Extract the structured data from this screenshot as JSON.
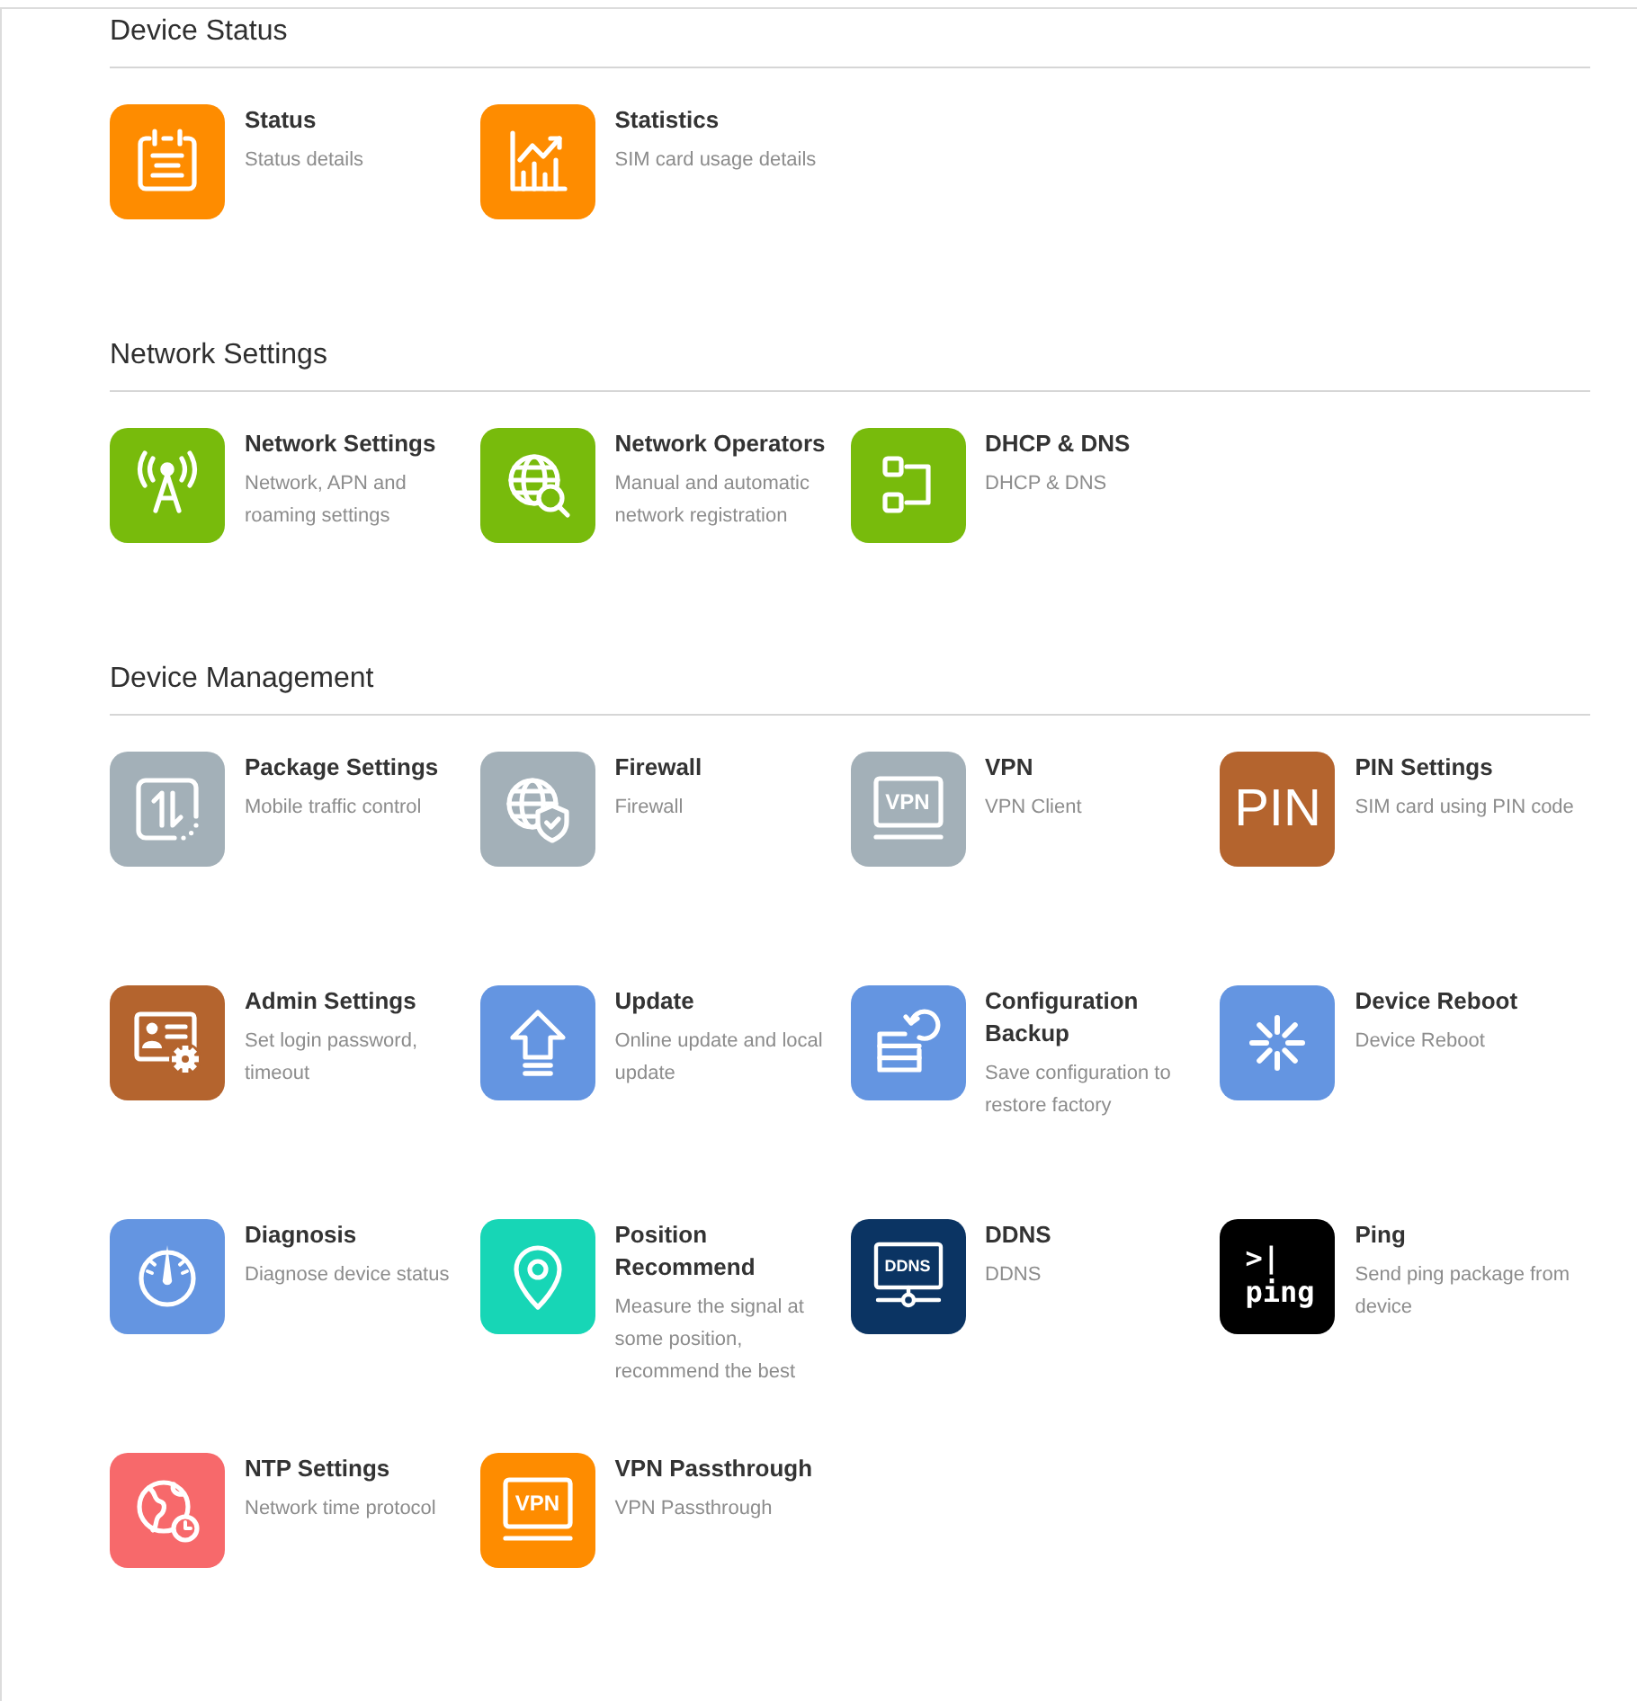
{
  "sections": [
    {
      "title": "Device Status",
      "items": [
        {
          "title": "Status",
          "description": "Status details",
          "color": "#fe8c00"
        },
        {
          "title": "Statistics",
          "description": "SIM card usage details",
          "color": "#fe8c00"
        }
      ]
    },
    {
      "title": "Network Settings",
      "items": [
        {
          "title": "Network Settings",
          "description": "Network, APN and roaming settings",
          "color": "#78bb0c"
        },
        {
          "title": "Network Operators",
          "description": "Manual and automatic network registration",
          "color": "#78bb0c"
        },
        {
          "title": "DHCP & DNS",
          "description": "DHCP & DNS",
          "color": "#78bb0c"
        }
      ]
    },
    {
      "title": "Device Management",
      "items": [
        {
          "title": "Package Settings",
          "description": "Mobile traffic control",
          "color": "#a3b0b8"
        },
        {
          "title": "Firewall",
          "description": "Firewall",
          "color": "#a3b0b8"
        },
        {
          "title": "VPN",
          "description": "VPN Client",
          "color": "#a3b0b8",
          "icon_text": "VPN"
        },
        {
          "title": "PIN Settings",
          "description": "SIM card using PIN code",
          "color": "#b4642e",
          "icon_text": "PIN"
        },
        {
          "title": "Admin Settings",
          "description": "Set login password, timeout",
          "color": "#b4642e"
        },
        {
          "title": "Update",
          "description": "Online update and local update",
          "color": "#6495e1"
        },
        {
          "title": "Configuration Backup",
          "description": "Save configuration to restore factory",
          "color": "#6495e1"
        },
        {
          "title": "Device Reboot",
          "description": "Device Reboot",
          "color": "#6495e1"
        },
        {
          "title": "Diagnosis",
          "description": "Diagnose device status",
          "color": "#6495e1"
        },
        {
          "title": "Position Recommend",
          "description": "Measure the signal at some position, recommend the best",
          "color": "#17d6b6"
        },
        {
          "title": "DDNS",
          "description": "DDNS",
          "color": "#0b3463",
          "icon_text": "DDNS"
        },
        {
          "title": "Ping",
          "description": "Send ping package from device",
          "color": "#000000",
          "icon_lines": [
            ">|",
            "ping"
          ]
        },
        {
          "title": "NTP Settings",
          "description": "Network time protocol",
          "color": "#f7696b"
        },
        {
          "title": "VPN Passthrough",
          "description": "VPN Passthrough",
          "color": "#fe8c00",
          "icon_text": "VPN"
        }
      ]
    }
  ]
}
